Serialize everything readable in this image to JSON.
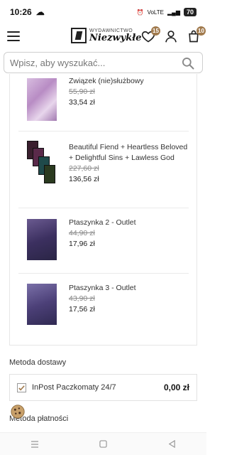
{
  "status_bar": {
    "time": "10:26",
    "battery": "70",
    "network": "VoLTE"
  },
  "header": {
    "logo_line1": "Wydawnictwo",
    "logo_line2": "Niezwykłe",
    "wishlist_count": "15",
    "cart_count": "10"
  },
  "search": {
    "placeholder": "Wpisz, aby wyszukać..."
  },
  "products": [
    {
      "title": "Związek (nie)służbowy",
      "old_price": "55,90 zł",
      "price": "33,54 zł",
      "cover_color": "#c9a3d1"
    },
    {
      "title": "Beautiful Fiend + Heartless Beloved + Delightful Sins + Lawless God",
      "old_price": "227,60 zł",
      "price": "136,56 zł",
      "cover_color": "#2d2a3a"
    },
    {
      "title": "Ptaszynka 2 - Outlet",
      "old_price": "44,90 zł",
      "price": "17,96 zł",
      "cover_color": "#4a3c6e"
    },
    {
      "title": "Ptaszynka 3 - Outlet",
      "old_price": "43,90 zł",
      "price": "17,56 zł",
      "cover_color": "#5b4e86"
    }
  ],
  "delivery": {
    "section_title": "Metoda dostawy",
    "option_label": "InPost Paczkomaty 24/7",
    "option_price": "0,00 zł",
    "checked": true
  },
  "payment": {
    "section_title": "Metoda płatności"
  },
  "colors": {
    "accent": "#a17a4d"
  }
}
